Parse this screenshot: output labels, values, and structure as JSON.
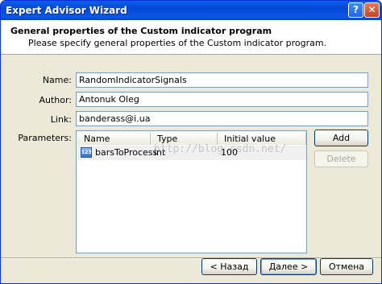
{
  "window": {
    "title": "Expert Advisor Wizard"
  },
  "titlebar_buttons": {
    "help_label": "?",
    "close_label": "✕"
  },
  "header": {
    "title": "General properties of the Custom indicator program",
    "subtitle": "Please specify general properties of the Custom indicator program."
  },
  "form": {
    "name_label": "Name:",
    "name_value": "RandomIndicatorSignals",
    "author_label": "Author:",
    "author_value": "Antonuk Oleg",
    "link_label": "Link:",
    "link_value": "banderass@i.ua",
    "parameters_label": "Parameters:"
  },
  "parameters": {
    "columns": [
      "Name",
      "Type",
      "Initial value"
    ],
    "rows": [
      {
        "icon": "123",
        "name": "barsToProcess",
        "type": "int",
        "initial": "100"
      }
    ]
  },
  "watermark": "http://blog.csdn.net/",
  "buttons": {
    "add": "Add",
    "delete": "Delete",
    "back": "< Назад",
    "next": "Далее >",
    "cancel": "Отмена"
  },
  "colors": {
    "titlebar": "#0a5fe8",
    "dialog_bg": "#ece9d8",
    "selected_row": "#f0f0f0"
  }
}
